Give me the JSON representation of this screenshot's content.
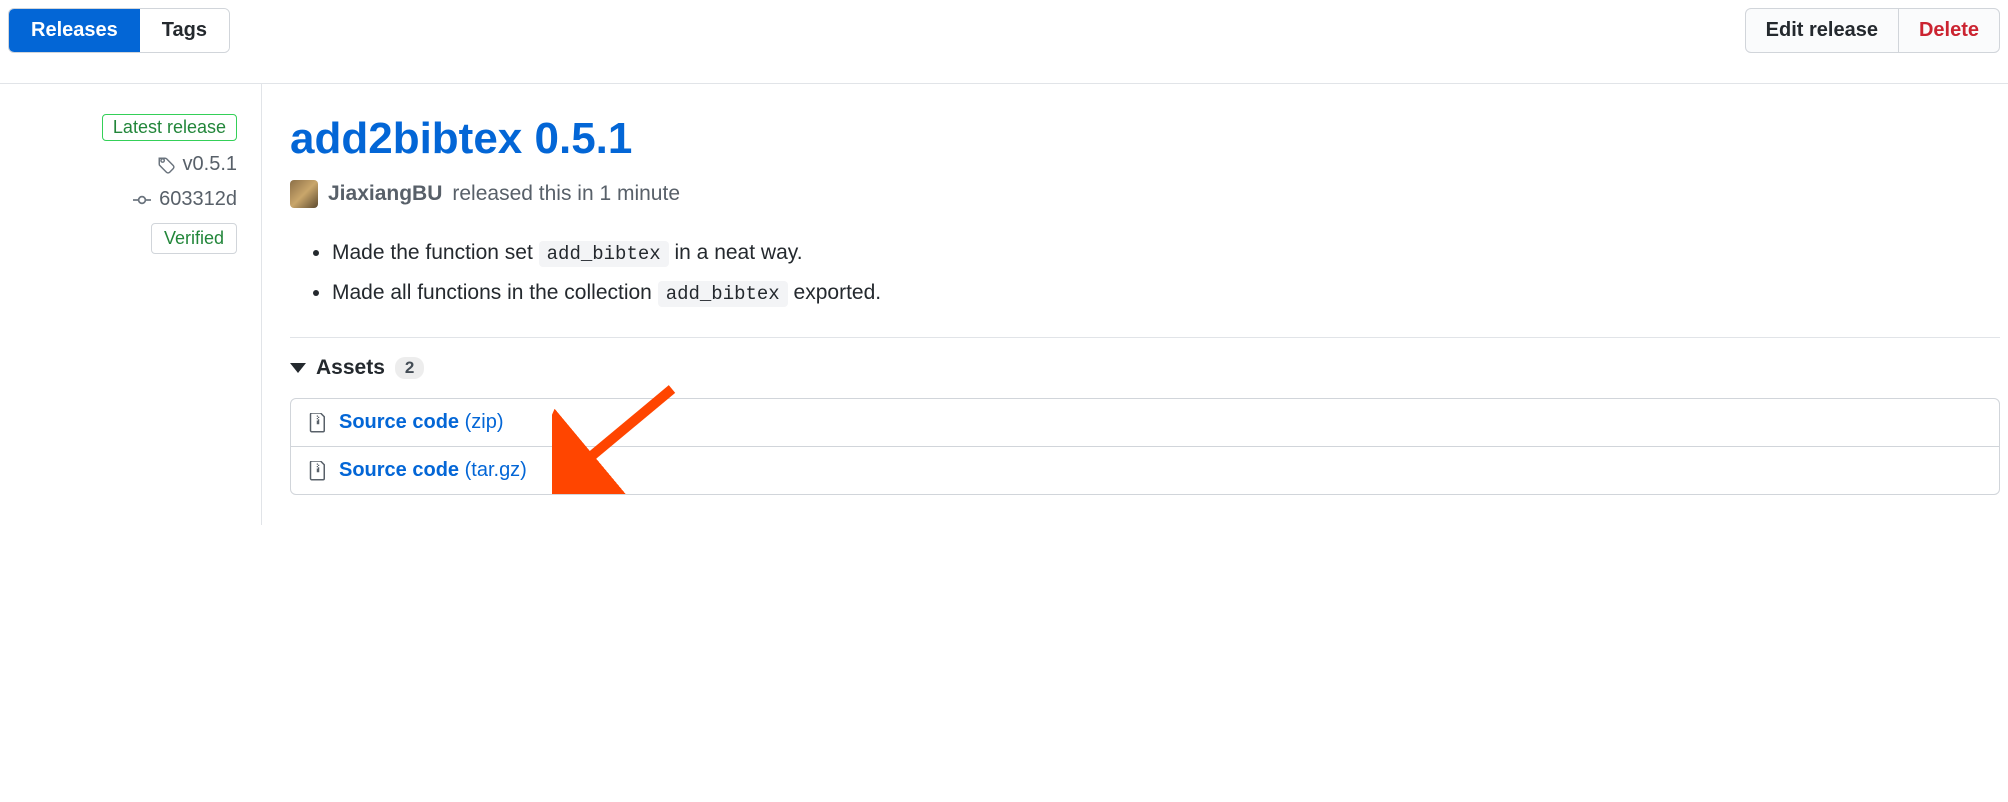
{
  "tabs": {
    "releases": "Releases",
    "tags": "Tags"
  },
  "actions": {
    "edit": "Edit release",
    "delete": "Delete"
  },
  "sidebar": {
    "latest": "Latest release",
    "tag": "v0.5.1",
    "commit": "603312d",
    "verified": "Verified"
  },
  "release": {
    "title": "add2bibtex 0.5.1",
    "author": "JiaxiangBU",
    "byline_rest": "released this in 1 minute",
    "notes": [
      {
        "pre": "Made the function set ",
        "code": "add_bibtex",
        "post": " in a neat way."
      },
      {
        "pre": "Made all functions in the collection ",
        "code": "add_bibtex",
        "post": " exported."
      }
    ]
  },
  "assets": {
    "header": "Assets",
    "count": "2",
    "items": [
      {
        "name": "Source code",
        "ext": "(zip)"
      },
      {
        "name": "Source code",
        "ext": "(tar.gz)"
      }
    ]
  }
}
